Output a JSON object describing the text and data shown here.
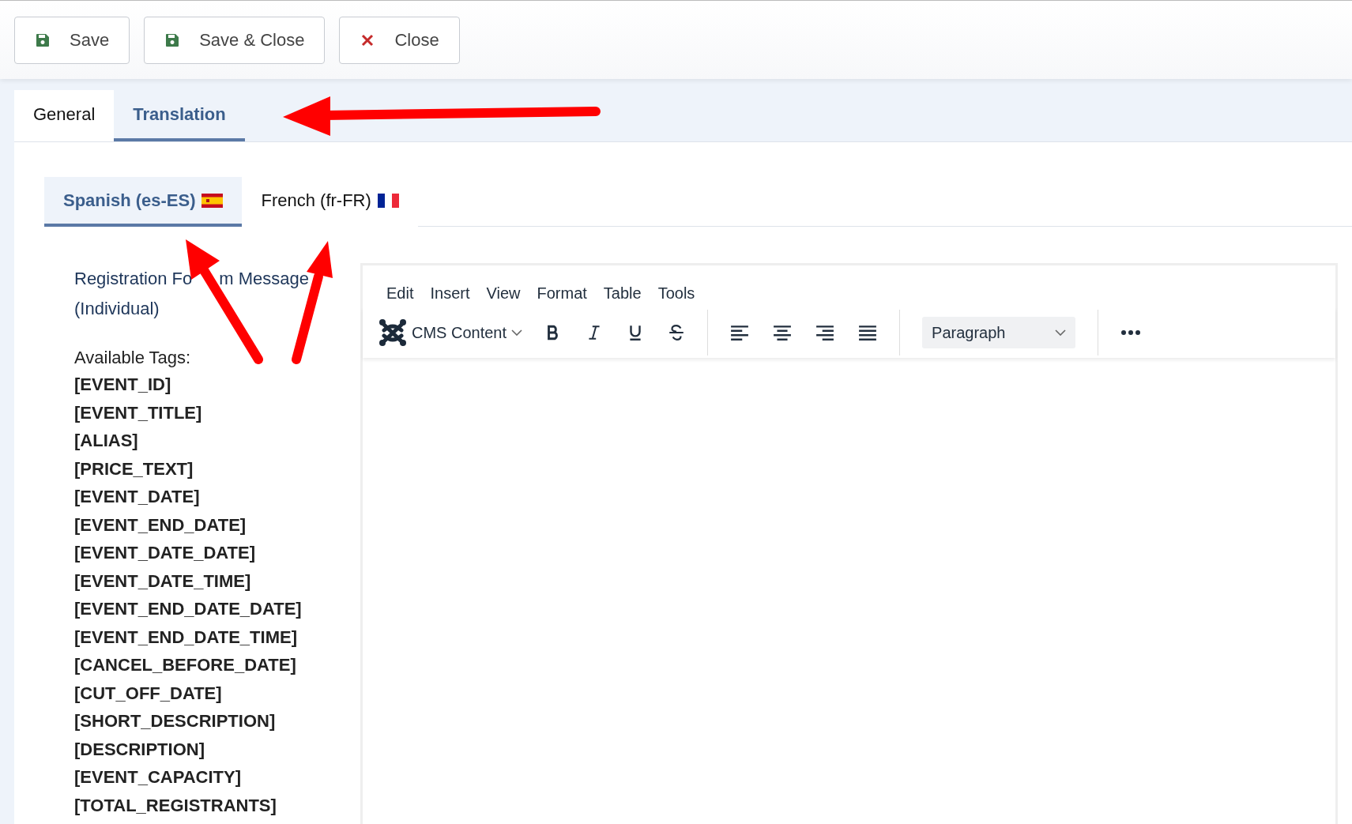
{
  "toolbar": {
    "buttons": [
      {
        "label": "Save",
        "kind": "save"
      },
      {
        "label": "Save & Close",
        "kind": "save"
      },
      {
        "label": "Close",
        "kind": "close"
      }
    ]
  },
  "tabs": [
    {
      "label": "General",
      "selected": false
    },
    {
      "label": "Translation",
      "selected": true
    }
  ],
  "language_tabs": [
    {
      "label": "Spanish (es-ES)",
      "kind": "spain",
      "selected": true
    },
    {
      "label": "French (fr-FR)",
      "kind": "france",
      "selected": false
    }
  ],
  "field": {
    "label_parts": [
      "Registration Fo",
      "m Message",
      "(Individual)"
    ],
    "help_title": "Available Tags:",
    "tags": [
      "[EVENT_ID]",
      "[EVENT_TITLE]",
      "[ALIAS]",
      "[PRICE_TEXT]",
      "[EVENT_DATE]",
      "[EVENT_END_DATE]",
      "[EVENT_DATE_DATE]",
      "[EVENT_DATE_TIME]",
      "[EVENT_END_DATE_DATE]",
      "[EVENT_END_DATE_TIME]",
      "[CANCEL_BEFORE_DATE]",
      "[CUT_OFF_DATE]",
      "[SHORT_DESCRIPTION]",
      "[DESCRIPTION]",
      "[EVENT_CAPACITY]",
      "[TOTAL_REGISTRANTS]"
    ]
  },
  "editor": {
    "menu": [
      "Edit",
      "Insert",
      "View",
      "Format",
      "Table",
      "Tools"
    ],
    "content_button": "CMS Content",
    "block_format": "Paragraph"
  }
}
